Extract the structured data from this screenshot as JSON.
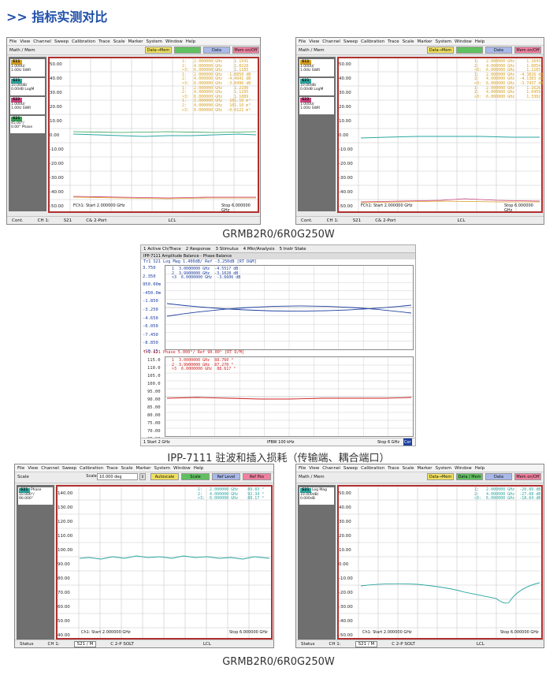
{
  "heading": ">> 指标实测对比",
  "captions": [
    "GRMB2R0/6R0G250W",
    "IPP-7111 驻波和插入损耗（传输端、耦合端口）",
    "GRMB2R0/6R0G250W"
  ],
  "vna_menu": [
    "File",
    "View",
    "Channel",
    "Sweep",
    "Calibration",
    "Trace",
    "Scale",
    "Marker",
    "System",
    "Window",
    "Help"
  ],
  "vna_top": {
    "toolbar_label": "Math / Mem",
    "btn1": "Data→Mem",
    "btn2": "Data / Mem",
    "btn3": "Data",
    "btn4": "Mem on/Off",
    "traces": [
      {
        "tag": "S11",
        "l1": "1.000U/",
        "l2": "1.00U",
        "l3": "SWR"
      },
      {
        "tag": "S21",
        "l1": "10.00dB/",
        "l2": "0.00dB",
        "l3": "LogM"
      },
      {
        "tag": "S22",
        "l1": "1.000U/",
        "l2": "1.00U",
        "l3": "SWR"
      },
      {
        "tag": "S21",
        "l1": "45.00°/",
        "l2": "0.00°",
        "l3": "Phase"
      }
    ],
    "yticks": [
      "50.00",
      "40.00",
      "30.00",
      "20.00",
      "10.00",
      "0.00",
      "-10.00",
      "-20.00",
      "-30.00",
      "-40.00",
      "-50.00"
    ],
    "markers_left": "1:   2.000000 GHz     1.1541\n2:   4.000000 GHz     1.0220\n>3:  6.000000 GHz     1.1105\n1:   2.000000 GHz  -1.0850 dB\n2:   4.000000 GHz  -4.4941 dB\n>3:  6.000000 GHz  -3.0496 dB\n1:   2.000000 GHz     1.2190\n2:   4.000000 GHz     1.1295\n>3:  6.000000 GHz     1.1089\n1:   2.000000 GHz   101.10 m°\n2:   4.000000 GHz   101.10 m°\n>3:  6.000000 GHz  -0.0121 m°",
    "markers_right": "1:   2.000000 GHz     1.1643\n2:   4.000000 GHz     1.0054\n>3:  6.000000 GHz     1.1165\n1:   2.000000 GHz  -4.3816 dB\n2:   4.000000 GHz  -4.1383 dB\n>3:  6.000000 GHz  -3.7437 dB\n1:   2.000000 GHz     1.1626\n2:   4.000000 GHz     1.0459\n>3:  6.000000 GHz     1.3302",
    "start_left": "FCh1: Start  2.000000 GHz",
    "start_right": "FCh1: Start  2.000000 GHz",
    "stop": "Stop  6.000000 GHz",
    "status": {
      "cont": "Cont.",
      "ch": "CH 1:",
      "meas": "S21",
      "cal": "C& 2-Port",
      "lcl": "LCL"
    }
  },
  "ipp": {
    "menu": [
      "1 Active Ch/Trace",
      "2 Response",
      "3 Stimulus",
      "4 Mkr/Analysis",
      "5 Instr State"
    ],
    "title": "IPP-7111 Amplitude Balance - Phase Balance",
    "tr1": "Tr1 S21 Log Mag 1.400dB/ Ref -3.250dB [RT D&M]",
    "tr1_markers": "1  3.0000000 GHz  -4.5517 dB\n2  3.9900000 GHz  -3.1028 dB\n>3  6.0000000 GHz  -3.6606 dB",
    "tr1_yticks": [
      "3.750",
      "2.350",
      "950.00m",
      "-450.0m",
      "-1.850",
      "-3.250",
      "-4.650",
      "-6.050",
      "-7.450",
      "-8.850",
      "-10.25"
    ],
    "tr2": "Tr2 S21 Phase 5.000°/ Ref 90.00° [RT D/M]",
    "tr2_markers": "1  3.0000000 GHz  88.760 °\n2  3.9900000 GHz  87.270 °\n>3  6.0000000 GHz  88.617 °",
    "tr2_yticks": [
      "115.0",
      "110.0",
      "105.0",
      "100.0",
      "95.00",
      "90.00",
      "85.00",
      "80.00",
      "75.00",
      "70.00",
      "65.00"
    ],
    "foot_start": "1  Start 2 GHz",
    "foot_ifbw": "IFBW 100 kHz",
    "foot_stop": "Stop 6 GHz",
    "foot_cor": "Cor"
  },
  "vna_bottom": {
    "left_toolbar": "Scale",
    "scale_value": "10.000 deg",
    "scale_btns": [
      "Autoscale",
      "Scale",
      "Ref Level",
      "Ref Pos"
    ],
    "right_toolbar": "Math / Mem",
    "left_trace": {
      "tag": "S21",
      "l1": "Phase",
      "l2": "10.000°/",
      "l3": "90.000°"
    },
    "right_trace": {
      "tag": "S21",
      "l1": "Log Mag",
      "l2": "10.000dB/",
      "l3": "0.000dB"
    },
    "left_yticks": [
      "140.00",
      "130.00",
      "120.00",
      "110.00",
      "100.00",
      "90.00",
      "80.00",
      "70.00",
      "60.00",
      "50.00",
      "40.00"
    ],
    "right_yticks": [
      "50.00",
      "40.00",
      "30.00",
      "20.00",
      "10.00",
      "0.00",
      "-10.00",
      "-20.00",
      "-30.00",
      "-40.00",
      "-50.00"
    ],
    "left_markers": "1:   2.000000 GHz    89.83 °\n2:   4.000000 GHz    92.34 °\n>3:  6.000000 GHz    88.17 °",
    "right_markers": "1:   2.000000 GHz  -20.89 dB\n2:   4.000000 GHz  -27.08 dB\n>3:  6.000000 GHz  -18.64 dB",
    "start": "Ch1: Start  2.000000 GHz",
    "stop": "Stop  6.000000 GHz",
    "status": {
      "status": "Status",
      "ch": "CH 1:",
      "meas": "S21 / M",
      "cal": "C  2-P SOLT",
      "lcl": "LCL"
    }
  },
  "colors": {
    "s11": "#d8a020",
    "s21": "#2aa6a0",
    "s22": "#d04080",
    "phase": "#30a050",
    "border": "#b03030",
    "ipp1": "#2040a0",
    "ipp2": "#d02020"
  }
}
